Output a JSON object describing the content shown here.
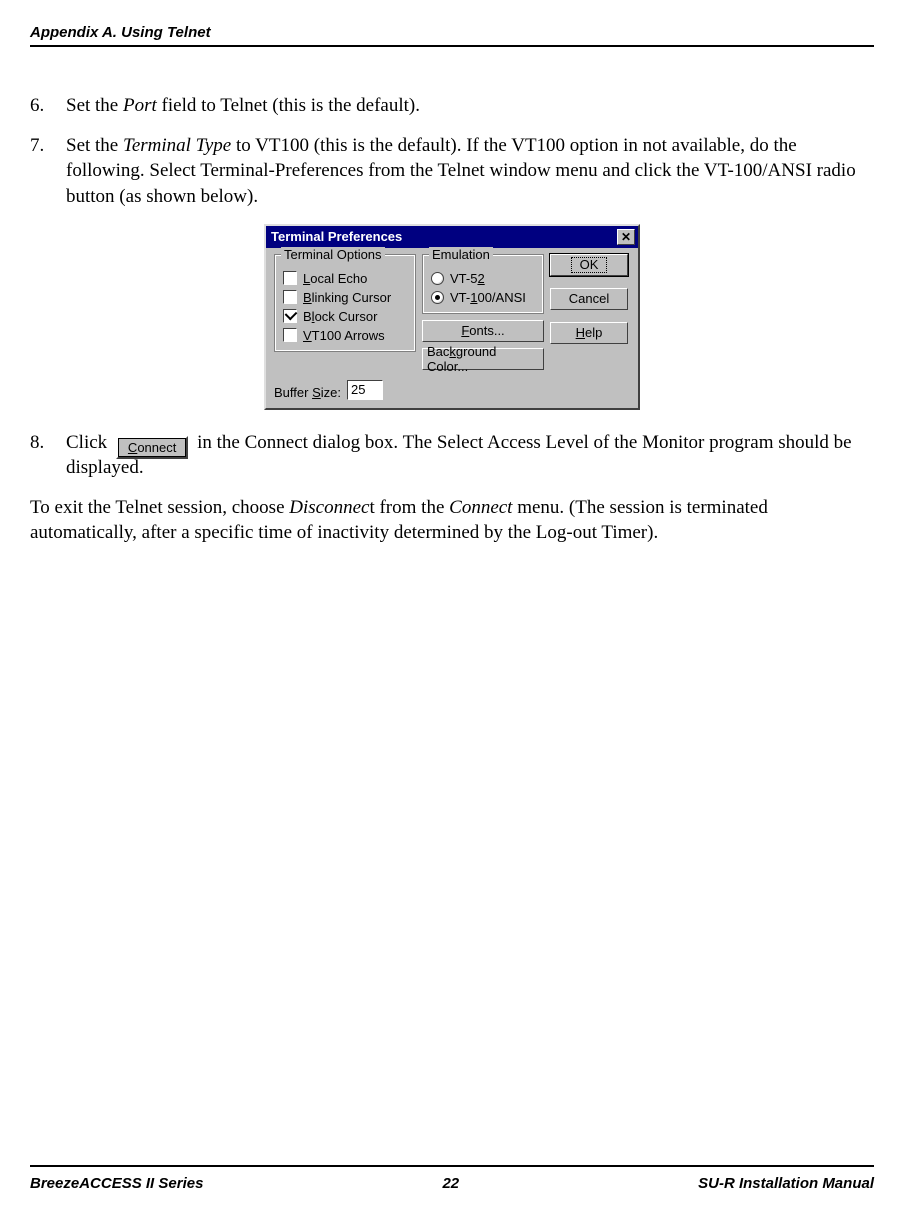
{
  "header": {
    "left": "Appendix A. Using Telnet",
    "right": ""
  },
  "steps": {
    "s6": {
      "num": "6.",
      "pre": "Set the ",
      "ital": "Port",
      "post": " field to Telnet (this is the default)."
    },
    "s7": {
      "num": "7.",
      "pre": "Set the ",
      "ital": "Terminal Type",
      "post": " to VT100 (this is the default). If the VT100 option in not available, do the following. Select Terminal-Preferences from the Telnet window menu and click the VT-100/ANSI radio button (as shown below)."
    },
    "s8": {
      "num": "8.",
      "pre": "Click ",
      "post1": " in the Connect dialog box. The Select Access Level of the Monitor program should be displayed."
    }
  },
  "dialog": {
    "title": "Terminal Preferences",
    "groups": {
      "termopts": {
        "label": "Terminal Options",
        "items": {
          "localecho": {
            "pre": "",
            "u": "L",
            "post": "ocal Echo"
          },
          "blinking": {
            "pre": "",
            "u": "B",
            "post": "linking Cursor"
          },
          "block": {
            "pre": "B",
            "u": "l",
            "post": "ock Cursor"
          },
          "vt100arrows": {
            "pre": "",
            "u": "V",
            "post": "T100 Arrows"
          }
        }
      },
      "emulation": {
        "label": "Emulation",
        "items": {
          "vt52": {
            "pre": "VT-5",
            "u": "2",
            "post": ""
          },
          "vt100": {
            "pre": "VT-",
            "u": "1",
            "post": "00/ANSI"
          }
        }
      }
    },
    "buttons": {
      "ok": "OK",
      "cancel": "Cancel",
      "help": {
        "pre": "",
        "u": "H",
        "post": "elp"
      },
      "fonts": {
        "pre": "",
        "u": "F",
        "post": "onts..."
      },
      "bgcolor": {
        "pre": "Bac",
        "u": "k",
        "post": "ground Color..."
      }
    },
    "buffer": {
      "label_pre": "Buffer ",
      "label_u": "S",
      "label_post": "ize:",
      "value": "25"
    }
  },
  "connectButton": {
    "u": "C",
    "post": "onnect"
  },
  "closingPara": {
    "pre": "To exit the Telnet session, choose ",
    "ital1": "Disconnec",
    "mid": "t from the ",
    "ital2": "Connect",
    "post": " menu. (The session is terminated automatically, after a specific time of inactivity determined by the Log-out Timer)."
  },
  "footer": {
    "left": "BreezeACCESS II Series",
    "center": "22",
    "right": "SU-R Installation Manual"
  }
}
